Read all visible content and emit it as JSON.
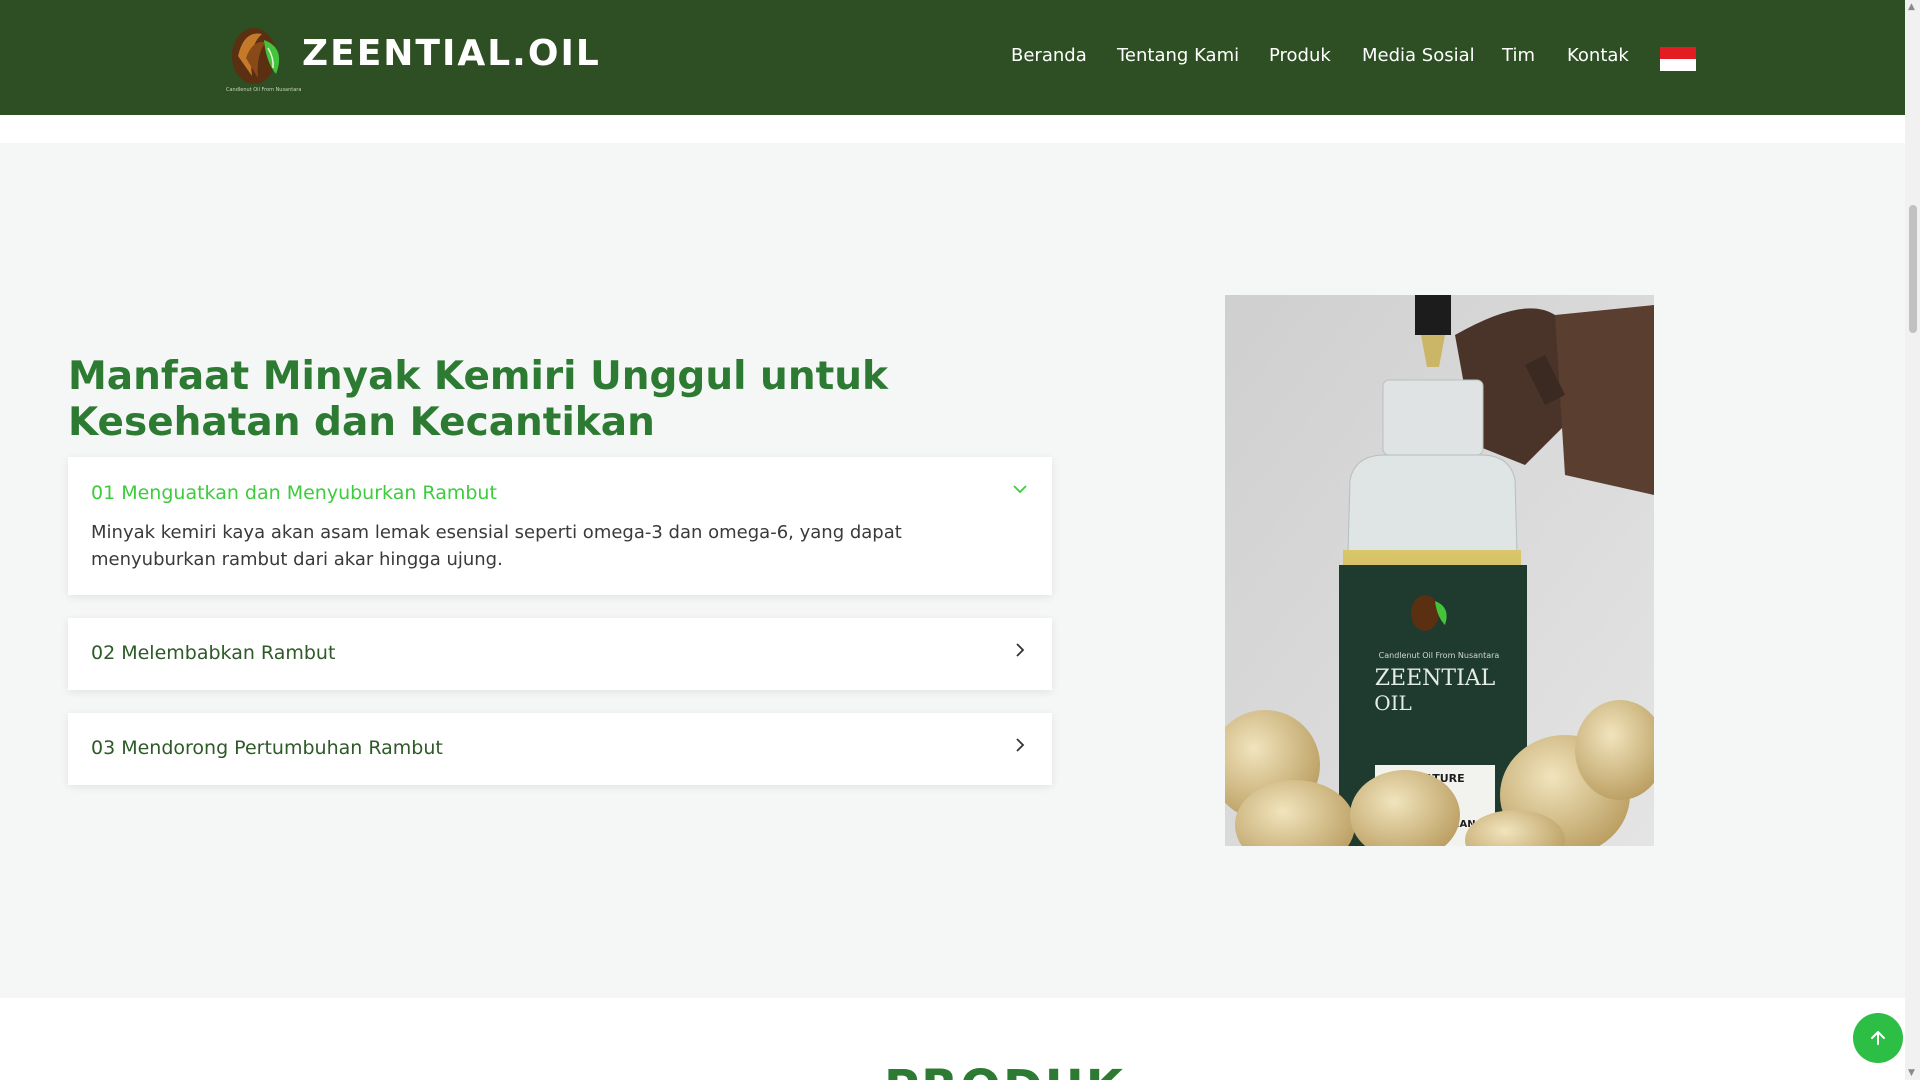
{
  "header": {
    "brand": "ZEENTIAL.OIL",
    "tagline": "Candlenut Oil From Nusantara",
    "nav": [
      "Beranda",
      "Tentang Kami",
      "Produk",
      "Media Sosial",
      "Tim",
      "Kontak"
    ],
    "language_flag": "indonesia-flag-icon",
    "background": "#2d4f23"
  },
  "section": {
    "heading": "Manfaat Minyak Kemiri Unggul untuk Kesehatan dan Kecantikan",
    "accordion": [
      {
        "title": "01 Menguatkan dan Menyuburkan Rambut",
        "body": "Minyak kemiri kaya akan asam lemak esensial seperti omega-3 dan omega-6, yang dapat menyuburkan rambut dari akar hingga ujung.",
        "expanded": true,
        "icon": "chevron-down-icon"
      },
      {
        "title": "02 Melembabkan Rambut",
        "expanded": false,
        "icon": "chevron-right-icon"
      },
      {
        "title": "03 Mendorong Pertumbuhan Rambut",
        "expanded": false,
        "icon": "chevron-right-icon"
      }
    ],
    "bottle_label": {
      "small": "Candlenut Oil From Nusantara",
      "name_line1": "ZEENTIAL",
      "name_line2": "OIL",
      "nature": "NATURE",
      "origin": "INDONESIAN"
    }
  },
  "next_section": {
    "title": "PRODUK"
  },
  "colors": {
    "accent_green": "#2d7a33",
    "active_green": "#3ccc3c",
    "button_green": "#2dbe45"
  }
}
